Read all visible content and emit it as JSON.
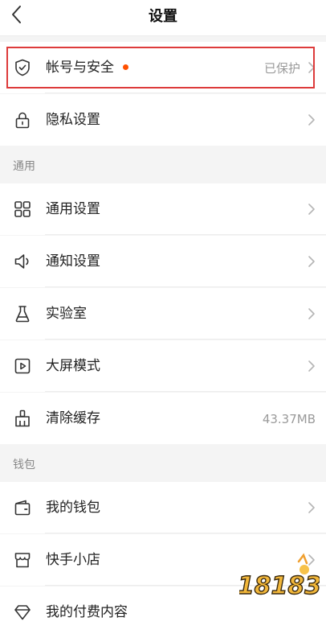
{
  "header": {
    "title": "设置",
    "back_icon": "chevron-left-icon"
  },
  "rows": {
    "account": {
      "label": "帐号与安全",
      "value": "已保护",
      "icon": "shield-icon",
      "dot_color": "#ff5000",
      "highlight_color": "#dd3b3b"
    },
    "privacy": {
      "label": "隐私设置",
      "icon": "lock-icon"
    },
    "general": {
      "label": "通用设置",
      "icon": "grid-icon"
    },
    "notify": {
      "label": "通知设置",
      "icon": "speaker-icon"
    },
    "lab": {
      "label": "实验室",
      "icon": "flask-icon"
    },
    "bigscreen": {
      "label": "大屏模式",
      "icon": "play-screen-icon"
    },
    "cache": {
      "label": "清除缓存",
      "value": "43.37MB",
      "icon": "broom-icon"
    },
    "wallet": {
      "label": "我的钱包",
      "icon": "wallet-icon"
    },
    "shop": {
      "label": "快手小店",
      "icon": "store-icon"
    },
    "paid": {
      "label": "我的付费内容",
      "icon": "diamond-icon"
    }
  },
  "sections": {
    "general": "通用",
    "wallet": "钱包"
  },
  "watermark": {
    "text": "18183"
  }
}
